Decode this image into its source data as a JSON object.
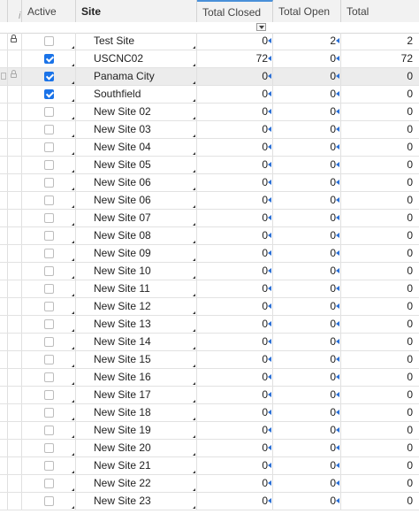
{
  "columns": {
    "info": "i",
    "active": "Active",
    "site": "Site",
    "total_closed": "Total Closed",
    "total_open": "Total Open",
    "total": "Total"
  },
  "rows": [
    {
      "active": false,
      "site": "Test Site",
      "closed": "0",
      "open": "2",
      "total": "2",
      "locked": true
    },
    {
      "active": true,
      "site": "USCNC02",
      "closed": "72",
      "open": "0",
      "total": "72"
    },
    {
      "active": true,
      "site": "Panama City",
      "closed": "0",
      "open": "0",
      "total": "0",
      "selected": true
    },
    {
      "active": true,
      "site": "Southfield",
      "closed": "0",
      "open": "0",
      "total": "0"
    },
    {
      "active": false,
      "site": "New Site 02",
      "closed": "0",
      "open": "0",
      "total": "0"
    },
    {
      "active": false,
      "site": "New Site 03",
      "closed": "0",
      "open": "0",
      "total": "0"
    },
    {
      "active": false,
      "site": "New Site 04",
      "closed": "0",
      "open": "0",
      "total": "0"
    },
    {
      "active": false,
      "site": "New Site 05",
      "closed": "0",
      "open": "0",
      "total": "0"
    },
    {
      "active": false,
      "site": "New Site 06",
      "closed": "0",
      "open": "0",
      "total": "0"
    },
    {
      "active": false,
      "site": "New Site 06",
      "closed": "0",
      "open": "0",
      "total": "0"
    },
    {
      "active": false,
      "site": "New Site 07",
      "closed": "0",
      "open": "0",
      "total": "0"
    },
    {
      "active": false,
      "site": "New Site 08",
      "closed": "0",
      "open": "0",
      "total": "0"
    },
    {
      "active": false,
      "site": "New Site 09",
      "closed": "0",
      "open": "0",
      "total": "0"
    },
    {
      "active": false,
      "site": "New Site 10",
      "closed": "0",
      "open": "0",
      "total": "0"
    },
    {
      "active": false,
      "site": "New Site 11",
      "closed": "0",
      "open": "0",
      "total": "0"
    },
    {
      "active": false,
      "site": "New Site 12",
      "closed": "0",
      "open": "0",
      "total": "0"
    },
    {
      "active": false,
      "site": "New Site 13",
      "closed": "0",
      "open": "0",
      "total": "0"
    },
    {
      "active": false,
      "site": "New Site 14",
      "closed": "0",
      "open": "0",
      "total": "0"
    },
    {
      "active": false,
      "site": "New Site 15",
      "closed": "0",
      "open": "0",
      "total": "0"
    },
    {
      "active": false,
      "site": "New Site 16",
      "closed": "0",
      "open": "0",
      "total": "0"
    },
    {
      "active": false,
      "site": "New Site 17",
      "closed": "0",
      "open": "0",
      "total": "0"
    },
    {
      "active": false,
      "site": "New Site 18",
      "closed": "0",
      "open": "0",
      "total": "0"
    },
    {
      "active": false,
      "site": "New Site 19",
      "closed": "0",
      "open": "0",
      "total": "0"
    },
    {
      "active": false,
      "site": "New Site 20",
      "closed": "0",
      "open": "0",
      "total": "0"
    },
    {
      "active": false,
      "site": "New Site 21",
      "closed": "0",
      "open": "0",
      "total": "0"
    },
    {
      "active": false,
      "site": "New Site 22",
      "closed": "0",
      "open": "0",
      "total": "0"
    },
    {
      "active": false,
      "site": "New Site 23",
      "closed": "0",
      "open": "0",
      "total": "0"
    }
  ],
  "colors": {
    "accent": "#1a73e8",
    "sort_indicator": "#4a90d9"
  },
  "icons": {
    "lock": "lock-icon",
    "filter": "filter-dropdown-icon",
    "checkbox": "checkbox"
  }
}
